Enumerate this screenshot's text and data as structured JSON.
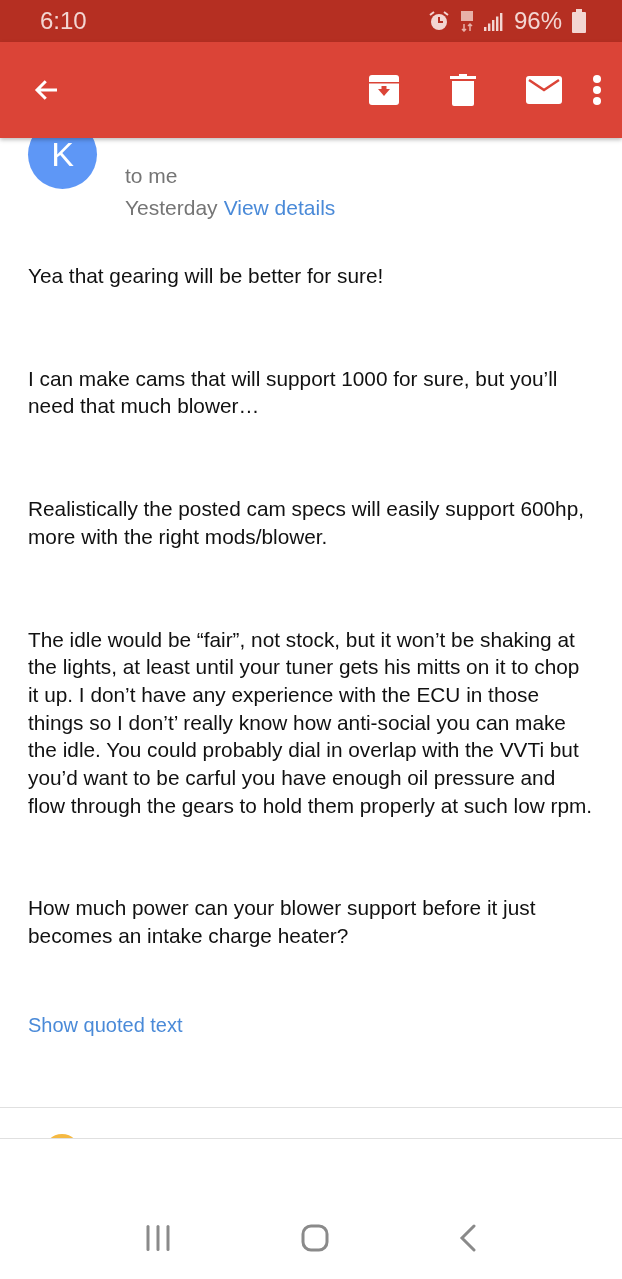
{
  "status_bar": {
    "time": "6:10",
    "battery": "96%"
  },
  "header": {
    "avatar_letter": "K",
    "recipient": "to me",
    "date": "Yesterday",
    "details_link": "View details"
  },
  "body": [
    "Yea that gearing will be better for sure!",
    "I can make cams that will support 1000 for sure, but you’ll need that much blower…",
    "Realistically the posted cam specs will easily support 600hp, more with the right mods/blower.",
    "The idle would be “fair”, not stock, but it won’t be shaking at the lights, at least until your tuner gets his mitts on it to chop it up. I don’t have any experience with the ECU in those things so I don’t’ really know how anti-social you can make the idle. You could probably dial in overlap with the VVTi but you’d want to be carful you have enough oil pressure and flow through the gears to hold them properly at such low rpm.",
    "How much power can your blower support before it just becomes an intake charge heater?"
  ],
  "show_quoted": "Show quoted text"
}
